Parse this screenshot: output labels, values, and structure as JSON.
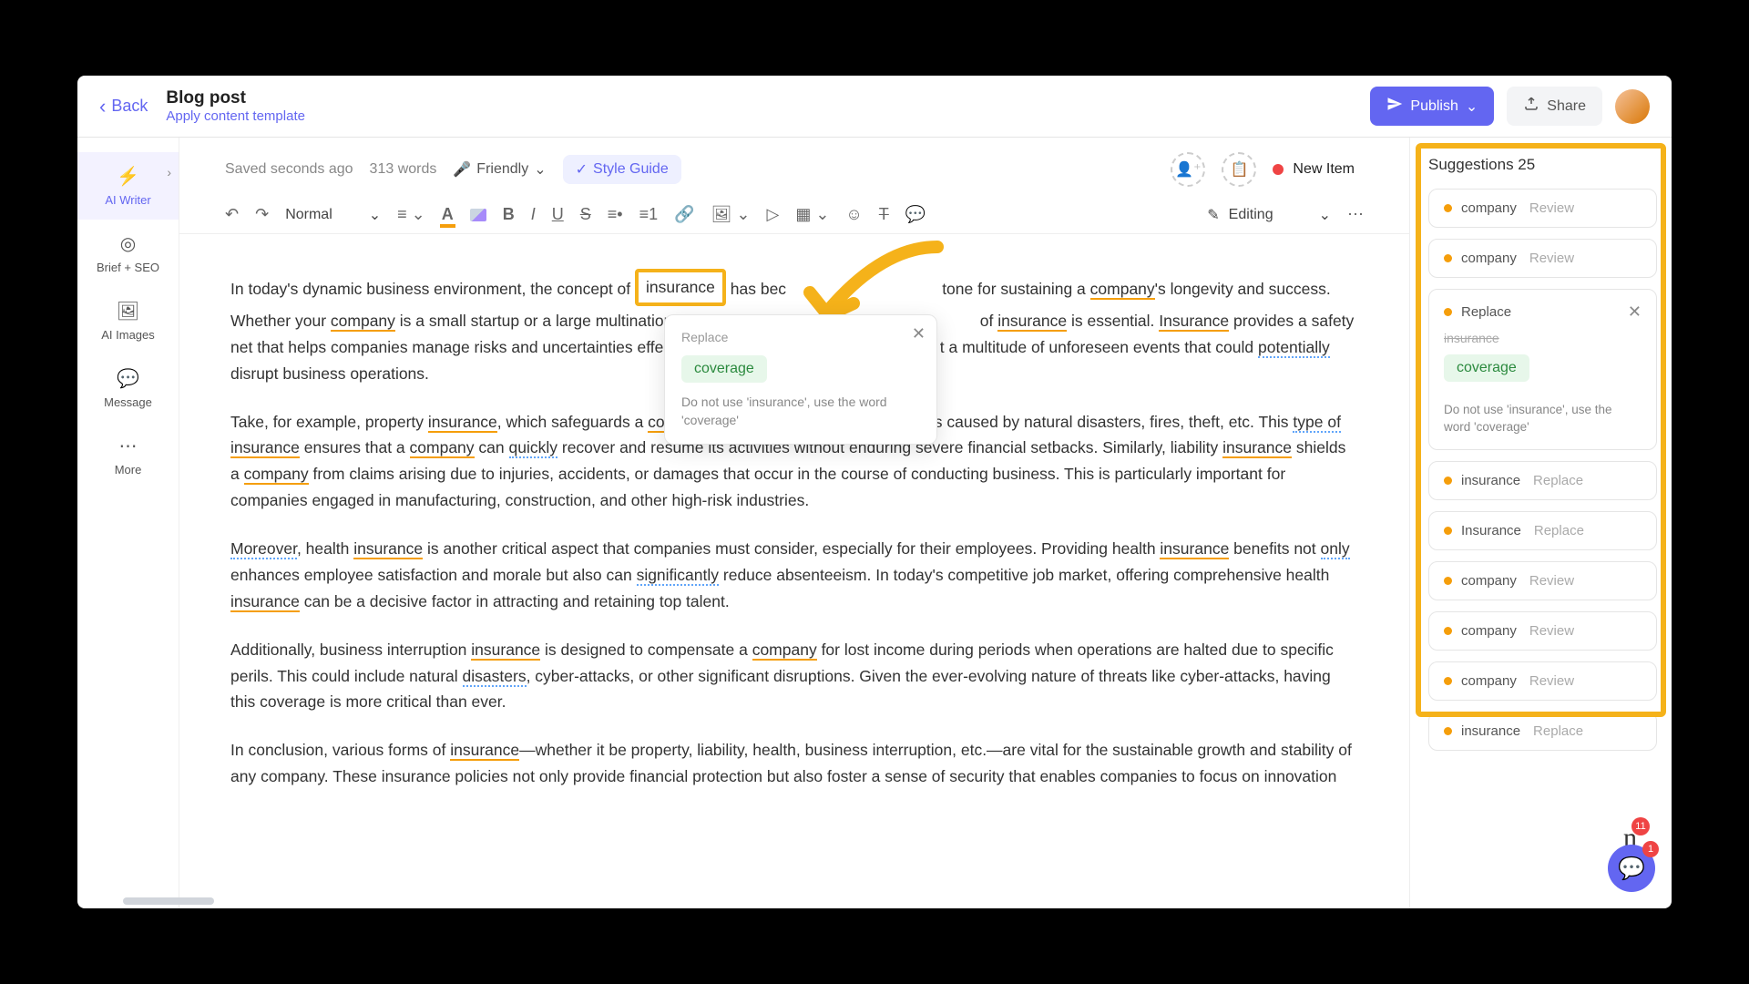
{
  "header": {
    "back": "Back",
    "title": "Blog post",
    "subtitle": "Apply content template",
    "publish": "Publish",
    "share": "Share"
  },
  "sidebar": {
    "items": [
      {
        "icon": "⚡",
        "label": "AI Writer"
      },
      {
        "icon": "◎",
        "label": "Brief + SEO"
      },
      {
        "icon": "🖼",
        "label": "AI Images"
      },
      {
        "icon": "💬",
        "label": "Message"
      },
      {
        "icon": "⋯",
        "label": "More"
      }
    ]
  },
  "info": {
    "saved": "Saved seconds ago",
    "word_count": "313 words",
    "tone": "Friendly",
    "styleguide": "Style Guide",
    "new_item": "New Item"
  },
  "toolbar": {
    "heading": "Normal",
    "editing": "Editing"
  },
  "popup": {
    "title": "Replace",
    "suggestion": "coverage",
    "note": "Do not use 'insurance', use the word 'coverage'"
  },
  "content": {
    "p1_a": "In today's dynamic business environment, the concept of ",
    "p1_boxed": "insurance",
    "p1_b": " has bec",
    "p1_c": "tone for sustaining a ",
    "p1_company": "company",
    "p1_d": "'s longevity and success. Whether your ",
    "p1_company2": "company",
    "p1_e": " is a small startup or a large multinational corp",
    "p1_f": "of ",
    "p1_insurance2": "insurance",
    "p1_g": " is essential. ",
    "p1_insurance3": "Insurance",
    "p1_h": " provides a safety net that helps companies manage risks and uncertainties effective",
    "p1_i": "t a multitude of unforeseen events that could ",
    "p1_potentially": "potentially",
    "p1_j": " disrupt business operations.",
    "p2_a": "Take, for example, property ",
    "p2_ins1": "insurance",
    "p2_b": ", which safeguards a ",
    "p2_comp1": "company'",
    "p2_c": "s physical assets from damages caused by natural disasters, fires, theft, etc. This ",
    "p2_type": "type of",
    "p2_sp": " ",
    "p2_ins2": "insurance",
    "p2_d": " ensures that a ",
    "p2_comp2": "company",
    "p2_e": " can ",
    "p2_quickly": "quickly",
    "p2_f": " recover and resume its activities without enduring severe financial setbacks. Similarly, liability ",
    "p2_ins3": "insurance",
    "p2_g": " shields a ",
    "p2_comp3": "company",
    "p2_h": " from claims arising due to injuries, accidents, or damages that occur in the course of conducting business. This is particularly important for companies engaged in manufacturing, construction, and other high-risk industries.",
    "p3_moreover": "Moreover",
    "p3_a": ", health ",
    "p3_ins1": "insurance",
    "p3_b": " is another critical aspect that companies must consider, especially for their employees. Providing health ",
    "p3_ins2": "insurance",
    "p3_c": " benefits not ",
    "p3_only": "only",
    "p3_d": " enhances employee satisfaction and morale but also can ",
    "p3_sig": "significantly",
    "p3_e": " reduce absenteeism. In today's competitive job market, offering comprehensive health ",
    "p3_ins3": "insurance",
    "p3_f": " can be a decisive factor in attracting and retaining top talent.",
    "p4_a": "Additionally, business interruption ",
    "p4_ins1": "insurance",
    "p4_b": " is designed to compensate a ",
    "p4_comp1": "company",
    "p4_c": " for lost income during periods when operations are halted due to specific perils. This could include natural ",
    "p4_dis": "disasters",
    "p4_d": ", cyber-attacks, or other significant disruptions. Given the ever-evolving nature of threats like cyber-attacks, having this coverage is more critical than ever.",
    "p5_a": "In conclusion, various forms of ",
    "p5_ins1": "insurance",
    "p5_b": "—whether it be property, liability, health, business interruption, etc.—are vital for the sustainable growth and stability of any company. These insurance policies not only provide financial protection but also foster a sense of security that enables companies to focus on innovation"
  },
  "suggestions": {
    "title": "Suggestions 25",
    "expanded": {
      "title": "Replace",
      "strike": "insurance",
      "suggestion": "coverage",
      "note": "Do not use 'insurance', use the word 'coverage'"
    },
    "items": [
      {
        "word": "company",
        "action": "Review"
      },
      {
        "word": "company",
        "action": "Review"
      },
      {
        "word": "insurance",
        "action": "Replace"
      },
      {
        "word": "Insurance",
        "action": "Replace"
      },
      {
        "word": "company",
        "action": "Review"
      },
      {
        "word": "company",
        "action": "Review"
      },
      {
        "word": "company",
        "action": "Review"
      },
      {
        "word": "insurance",
        "action": "Replace"
      }
    ]
  },
  "badges": {
    "logo": "11",
    "chat": "1"
  },
  "colors": {
    "accent": "#6366f1",
    "highlight": "#f5b21a",
    "warn": "#f59e0b"
  }
}
